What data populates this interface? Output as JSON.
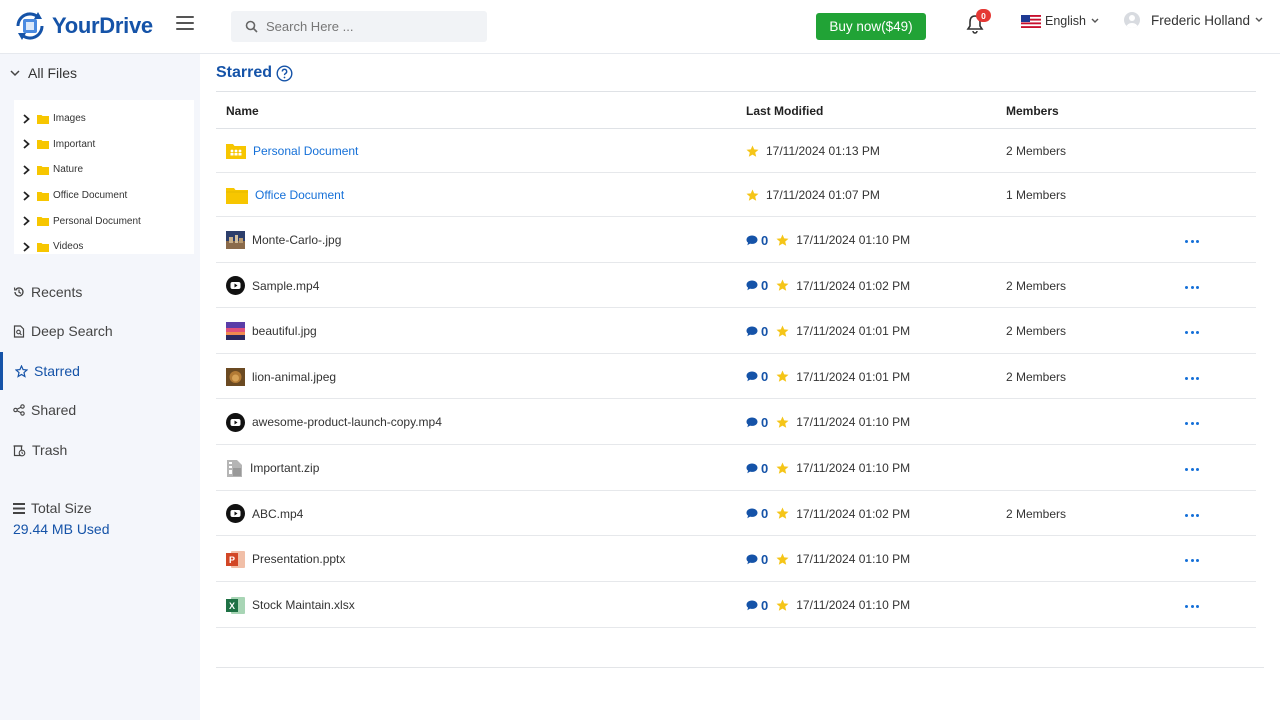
{
  "app": {
    "name": "YourDrive"
  },
  "header": {
    "search_placeholder": "Search Here ...",
    "buy_label": "Buy now($49)",
    "notification_count": "0",
    "language": "English",
    "user_name": "Frederic Holland"
  },
  "sidebar": {
    "all_files_label": "All Files",
    "folders": [
      {
        "label": "Images"
      },
      {
        "label": "Important"
      },
      {
        "label": "Nature"
      },
      {
        "label": "Office Document"
      },
      {
        "label": "Personal Document"
      },
      {
        "label": "Videos"
      }
    ],
    "nav": [
      {
        "label": "Recents",
        "icon": "history-icon"
      },
      {
        "label": "Deep Search",
        "icon": "file-search-icon"
      },
      {
        "label": "Starred",
        "icon": "star-outline-icon"
      },
      {
        "label": "Shared",
        "icon": "share-icon"
      },
      {
        "label": "Trash",
        "icon": "trash-icon"
      }
    ],
    "active_nav": "Starred",
    "total_size_label": "Total Size",
    "used_label": "29.44 MB Used"
  },
  "main": {
    "title": "Starred",
    "columns": {
      "name": "Name",
      "last_modified": "Last Modified",
      "members": "Members"
    },
    "rows": [
      {
        "name": "Personal Document",
        "type": "shared-folder",
        "comments": "",
        "modified": "17/11/2024 01:13 PM",
        "members": "2 Members"
      },
      {
        "name": "Office Document",
        "type": "folder",
        "comments": "",
        "modified": "17/11/2024 01:07 PM",
        "members": "1 Members"
      },
      {
        "name": "Monte-Carlo-.jpg",
        "type": "image-city",
        "comments": "0",
        "modified": "17/11/2024 01:10 PM",
        "members": ""
      },
      {
        "name": "Sample.mp4",
        "type": "video",
        "comments": "0",
        "modified": "17/11/2024 01:02 PM",
        "members": "2 Members"
      },
      {
        "name": "beautiful.jpg",
        "type": "image-sunset",
        "comments": "0",
        "modified": "17/11/2024 01:01 PM",
        "members": "2 Members"
      },
      {
        "name": "lion-animal.jpeg",
        "type": "image-lion",
        "comments": "0",
        "modified": "17/11/2024 01:01 PM",
        "members": "2 Members"
      },
      {
        "name": "awesome-product-launch-copy.mp4",
        "type": "video",
        "comments": "0",
        "modified": "17/11/2024 01:10 PM",
        "members": ""
      },
      {
        "name": "Important.zip",
        "type": "zip",
        "comments": "0",
        "modified": "17/11/2024 01:10 PM",
        "members": ""
      },
      {
        "name": "ABC.mp4",
        "type": "video",
        "comments": "0",
        "modified": "17/11/2024 01:02 PM",
        "members": "2 Members"
      },
      {
        "name": "Presentation.pptx",
        "type": "pptx",
        "comments": "0",
        "modified": "17/11/2024 01:10 PM",
        "members": ""
      },
      {
        "name": "Stock Maintain.xlsx",
        "type": "xlsx",
        "comments": "0",
        "modified": "17/11/2024 01:10 PM",
        "members": ""
      }
    ]
  },
  "colors": {
    "brand": "#1553a8",
    "link": "#1570d8",
    "buy": "#21a336",
    "star": "#f5c518",
    "folder": "#f7c600"
  }
}
